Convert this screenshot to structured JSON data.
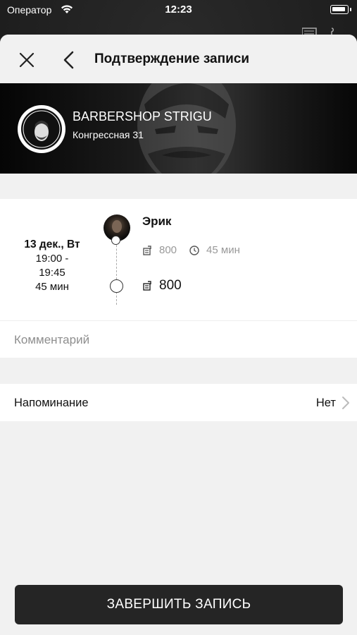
{
  "status_bar": {
    "carrier": "Оператор",
    "time": "12:23"
  },
  "header": {
    "title": "Подтверждение записи"
  },
  "shop": {
    "name": "BARBERSHOP STRIGU",
    "address": "Конгрессная 31"
  },
  "booking": {
    "date": "13 дек., Вт",
    "time_start": "19:00 -",
    "time_end": "19:45",
    "duration": "45 мин",
    "master_name": "Эрик",
    "service_price": "800",
    "service_duration": "45 мин",
    "total": "800"
  },
  "comment": {
    "placeholder": "Комментарий"
  },
  "reminder": {
    "label": "Напоминание",
    "value": "Нет"
  },
  "actions": {
    "finish_label": "ЗАВЕРШИТЬ ЗАПИСЬ"
  },
  "icons": {
    "close": "close-icon",
    "back": "chevron-left-icon",
    "price": "price-tag-icon",
    "duration": "clock-icon",
    "reminder_chevron": "chevron-right-icon"
  }
}
